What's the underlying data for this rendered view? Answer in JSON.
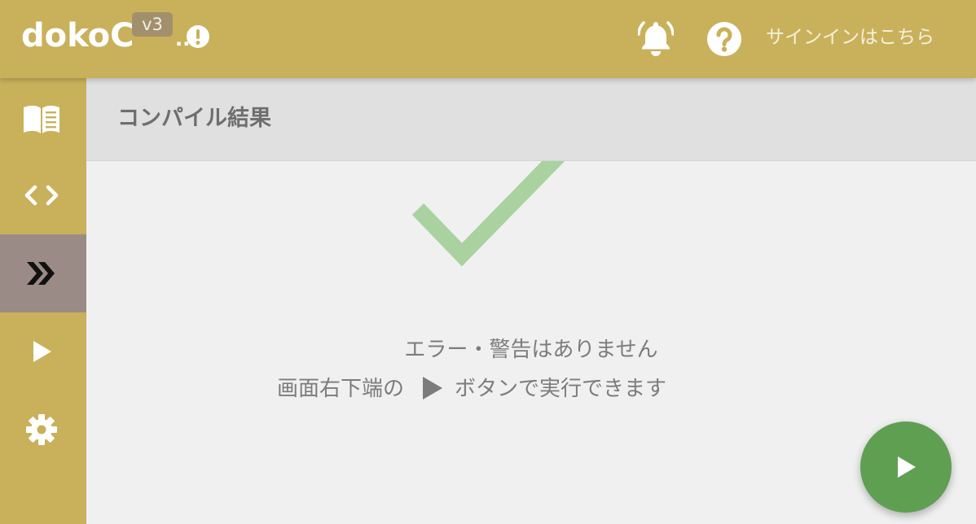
{
  "header": {
    "brand": "dokoC",
    "version": "v3",
    "dots": "..",
    "signin_label": "サインインはこちら"
  },
  "sidebar": {
    "items": [
      {
        "icon": "book-icon",
        "active": false
      },
      {
        "icon": "code-icon",
        "active": false
      },
      {
        "icon": "double-chevron-right-icon",
        "active": true
      },
      {
        "icon": "play-icon",
        "active": false
      },
      {
        "icon": "gear-icon",
        "active": false
      }
    ]
  },
  "panel": {
    "title": "コンパイル結果"
  },
  "result": {
    "status_icon": "check-icon",
    "message_line1": "エラー・警告はありません",
    "message_line2_prefix": "画面右下端の",
    "message_line2_suffix": "ボタンで実行できます"
  },
  "colors": {
    "header_bg": "#c9b15b",
    "sidebar_active": "#9b8b86",
    "check_green": "#a9d2a0",
    "fab_green": "#5f9f52"
  }
}
